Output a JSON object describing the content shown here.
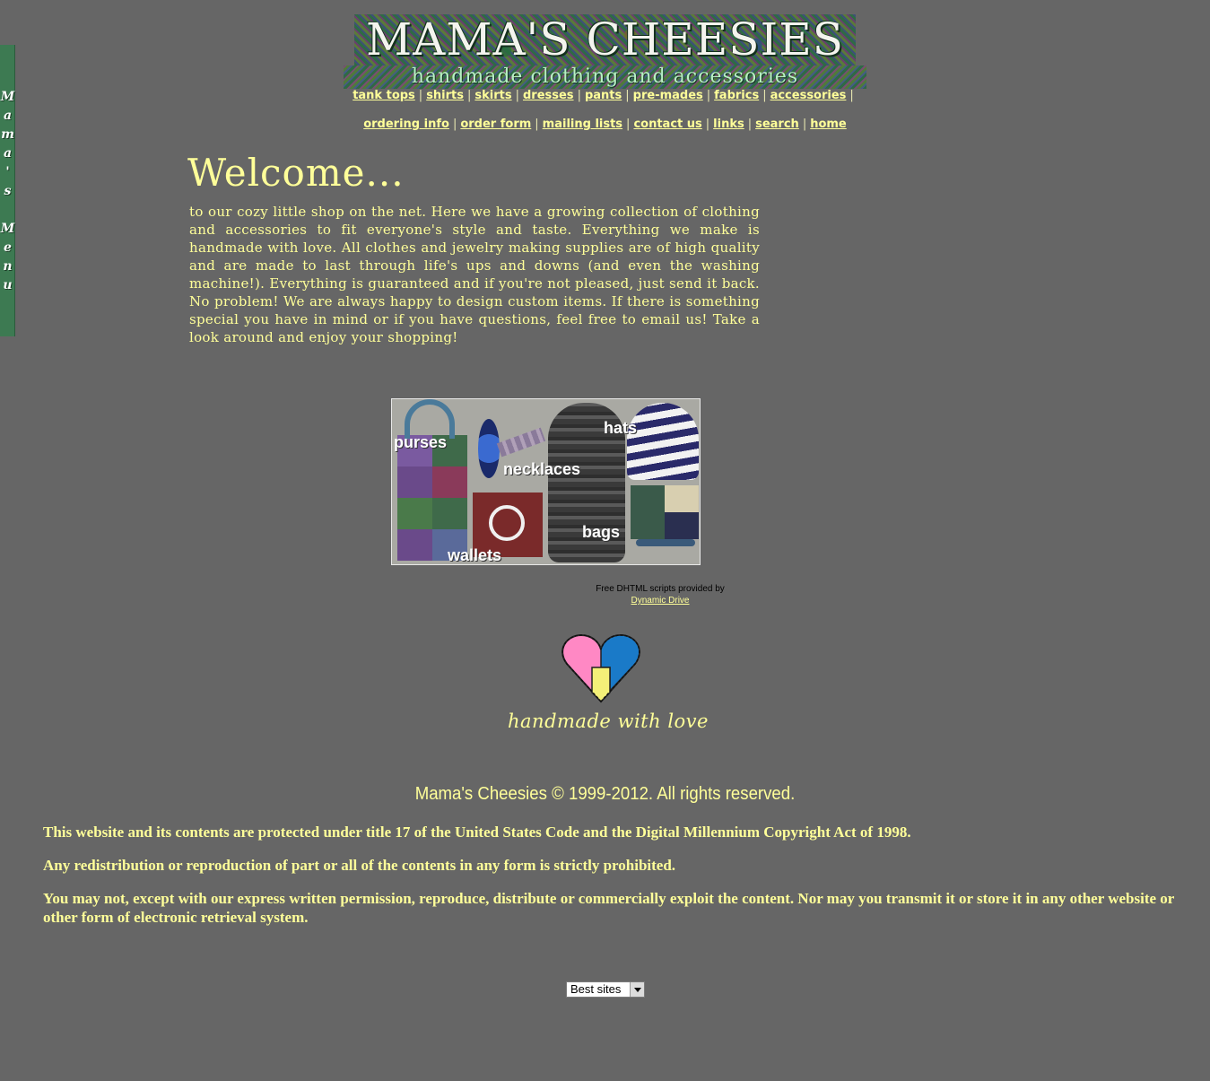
{
  "banner": {
    "title": "MAMA'S CHEESIES",
    "subtitle": "handmade clothing and accessories"
  },
  "side_menu": {
    "letters": [
      "M",
      "a",
      "m",
      "a",
      "'",
      "s",
      "",
      "M",
      "e",
      "n",
      "u"
    ]
  },
  "nav": {
    "row1": [
      "tank tops",
      "shirts",
      "skirts",
      "dresses",
      "pants",
      "pre-mades",
      "fabrics",
      "accessories"
    ],
    "row2": [
      "ordering info",
      "order form",
      "mailing lists",
      "contact us",
      "links",
      "search",
      "home"
    ]
  },
  "welcome": {
    "title": "Welcome...",
    "body": "to our cozy little shop on the net. Here we have a growing collection of clothing and accessories to fit everyone's style and taste. Everything we make is handmade with love. All clothes and jewelry making supplies are of high quality and are made to last through life's ups and downs (and even the washing machine!). Everything is guaranteed and if you're not pleased, just send it back. No problem! We are always happy to design custom items. If there is something special you have in mind or if you have questions, feel free to email us! Take a look around and enjoy your shopping!"
  },
  "collage": {
    "labels": {
      "purses": "purses",
      "necklaces": "necklaces",
      "hats": "hats",
      "bags": "bags",
      "wallets": "wallets"
    }
  },
  "credit": {
    "line": "Free DHTML scripts provided by",
    "link": "Dynamic Drive"
  },
  "love": {
    "text": "handmade with love"
  },
  "footer": {
    "copyright": "Mama's Cheesies © 1999-2012. All rights reserved.",
    "p1": "This website and its contents are protected under title 17 of the United States Code and the Digital Millennium Copyright Act of 1998.",
    "p2": "Any redistribution or reproduction of part or all of the contents in any form is strictly prohibited.",
    "p3": "You may not, except with our express written permission, reproduce, distribute or commercially exploit the content. Nor may you transmit it or store it in any other website or other form of electronic retrieval system."
  },
  "best_sites": {
    "selected": "Best sites"
  },
  "colors": {
    "background": "#666666",
    "text": "#ffff99",
    "menu_tab": "#3d7a52"
  }
}
